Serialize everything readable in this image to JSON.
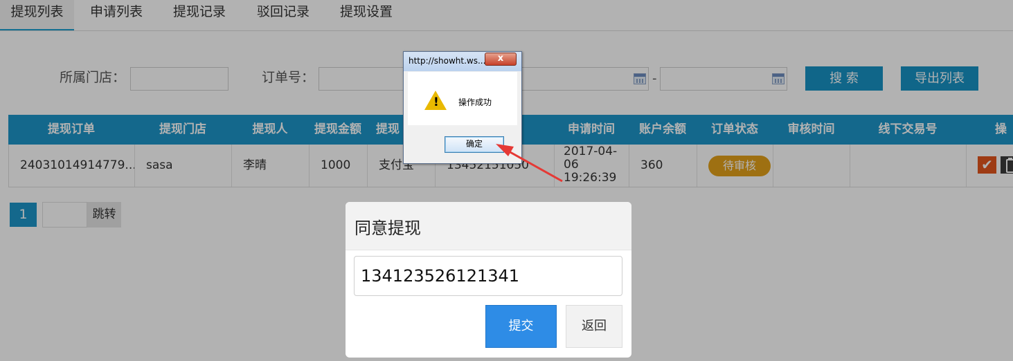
{
  "tabs": [
    {
      "label": "提现列表",
      "active": true
    },
    {
      "label": "申请列表",
      "active": false
    },
    {
      "label": "提现记录",
      "active": false
    },
    {
      "label": "驳回记录",
      "active": false
    },
    {
      "label": "提现设置",
      "active": false
    }
  ],
  "search": {
    "store_label": "所属门店：",
    "order_label": "订单号：",
    "store_value": "",
    "order_value": "",
    "date_start": "",
    "date_end": "",
    "range_separator": "-",
    "search_button": "搜 索",
    "export_button": "导出列表"
  },
  "table": {
    "headers": [
      "提现订单",
      "提现门店",
      "提现人",
      "提现金额",
      "提现",
      "申请时间",
      "账户余额",
      "订单状态",
      "审核时间",
      "线下交易号",
      "操"
    ],
    "rows": [
      {
        "order": "24031014914779...",
        "store": "sasa",
        "person": "李晴",
        "amount": "1000",
        "method": "支付宝",
        "account": "13452151050",
        "apply_date": "2017-04-",
        "apply_day": "06",
        "apply_time": "19:26:39",
        "balance": "360",
        "status": "待审核",
        "review_time": "",
        "offline_no": ""
      }
    ]
  },
  "pagination": {
    "current": "1",
    "jump_label": "跳转",
    "jump_value": ""
  },
  "dialog": {
    "title": "同意提现",
    "input_value": "134123526121341",
    "submit_label": "提交",
    "back_label": "返回"
  },
  "alert": {
    "title": "http://showht.ws...",
    "close_glyph": "x",
    "message": "操作成功",
    "warning_mark": "!",
    "ok_label": "确定"
  },
  "colors": {
    "primary": "#1d96c9",
    "status_pending": "#e3a11b",
    "approve_action": "#e2551d",
    "submit": "#2e8ce6",
    "annotation_arrow": "#e53935"
  },
  "icons": [
    "calendar-icon",
    "check-icon",
    "clipboard-icon",
    "warning-icon",
    "close-icon",
    "red-arrow"
  ]
}
